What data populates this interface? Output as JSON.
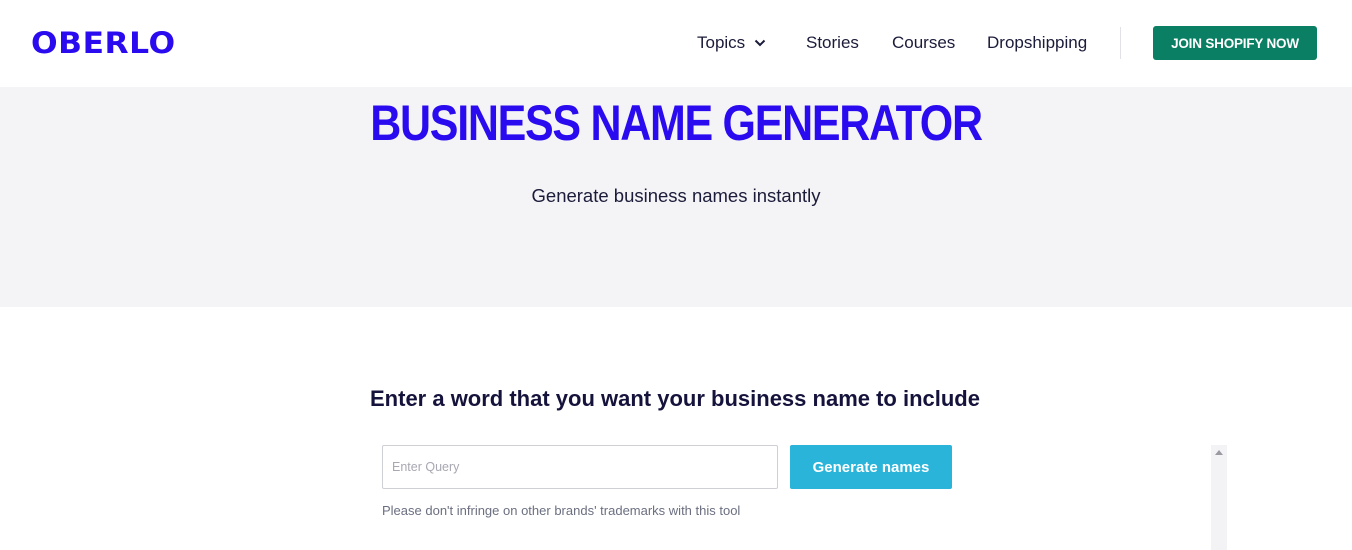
{
  "header": {
    "logo": "OBERLO",
    "nav": {
      "topics": "Topics",
      "stories": "Stories",
      "courses": "Courses",
      "dropshipping": "Dropshipping"
    },
    "cta_label": "JOIN SHOPIFY NOW"
  },
  "hero": {
    "title": "BUSINESS NAME GENERATOR",
    "subtitle": "Generate business names instantly"
  },
  "generator": {
    "prompt": "Enter a word that you want your business name to include",
    "input_value": "",
    "input_placeholder": "Enter Query",
    "button_label": "Generate names",
    "note": "Please don't infringe on other brands' trademarks with this tool"
  },
  "icons": {
    "topics_dropdown": "chevron-down-icon",
    "scroll_up": "scroll-up-arrow-icon"
  },
  "colors": {
    "brand": "#2a0aef",
    "cta": "#0b7f63",
    "generate_button": "#2ab4d9",
    "hero_background": "#f4f4f7"
  }
}
